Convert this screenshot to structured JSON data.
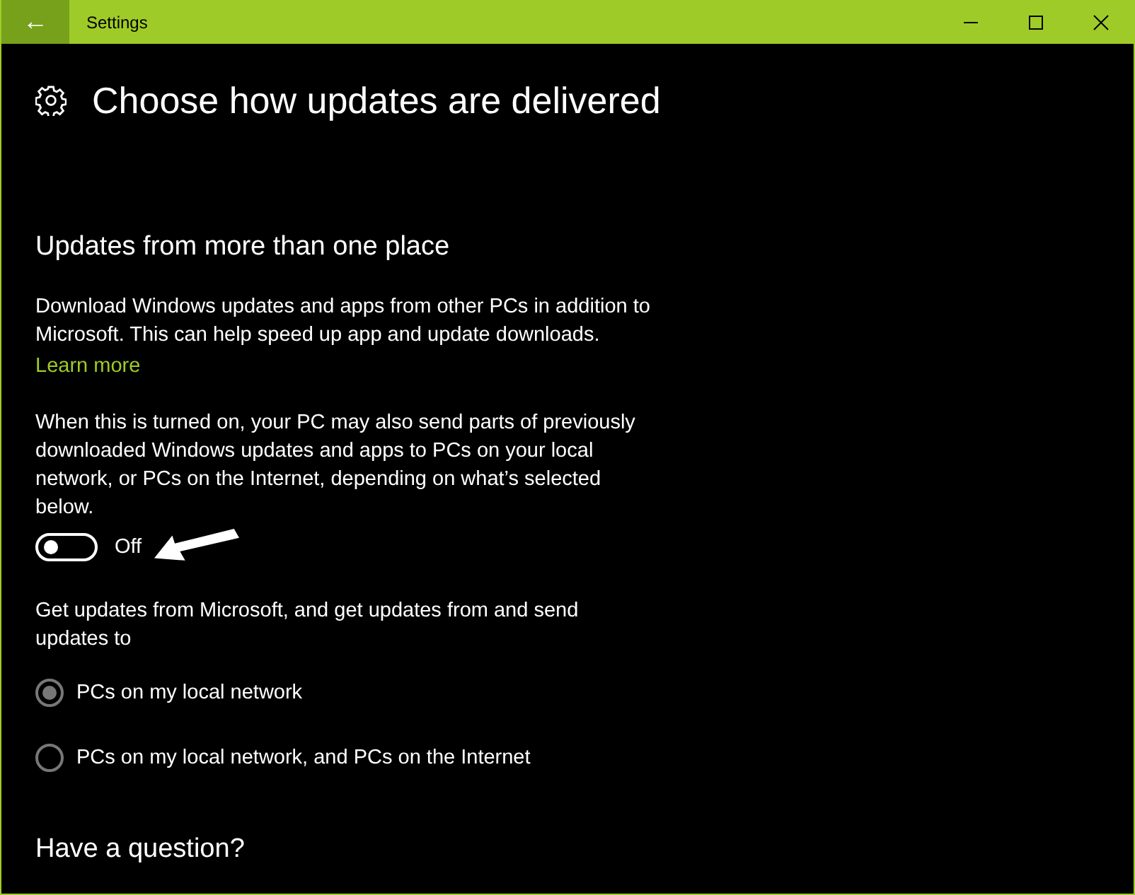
{
  "window": {
    "title": "Settings",
    "back": "←"
  },
  "page": {
    "title": "Choose how updates are delivered"
  },
  "section": {
    "heading": "Updates from more than one place",
    "description": "Download Windows updates and apps from other PCs in addition to Microsoft. This can help speed up app and update downloads.",
    "link": "Learn more",
    "note": "When this is turned on, your PC may also send parts of previously downloaded Windows updates and apps to PCs on your local network, or PCs on the Internet, depending on what’s selected below.",
    "toggle": {
      "on": false,
      "label": "Off"
    },
    "options_label": "Get updates from Microsoft, and get updates from and send updates to",
    "options": [
      {
        "label": "PCs on my local network",
        "selected": true
      },
      {
        "label": "PCs on my local network, and PCs on the Internet",
        "selected": false
      }
    ]
  },
  "help": {
    "heading": "Have a question?"
  }
}
